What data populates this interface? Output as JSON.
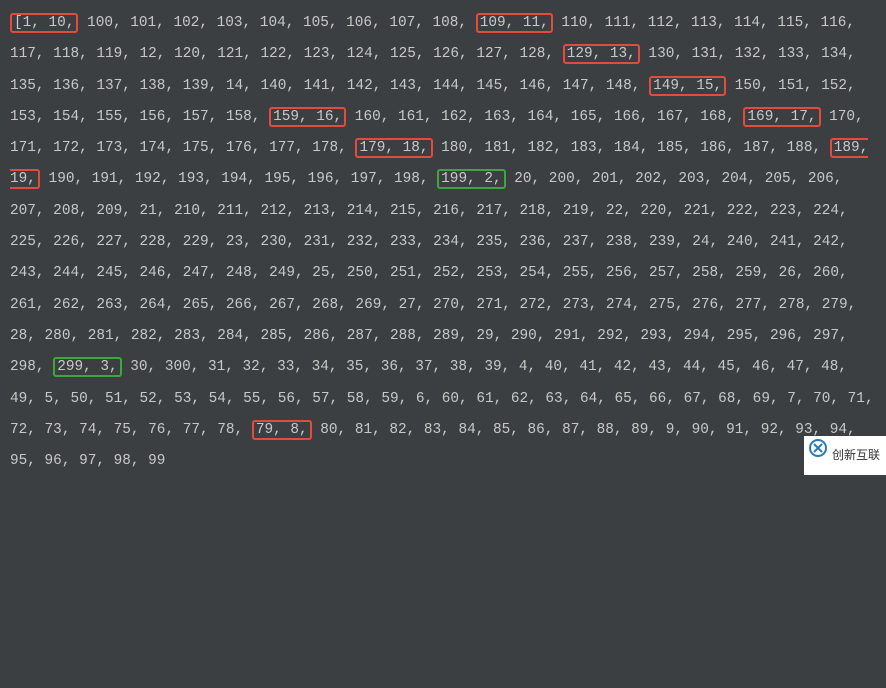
{
  "tokens": [
    {
      "text": "[1, 10,",
      "style": "box-red"
    },
    {
      "text": " 100, 101, 102, 103, 104, 105, 106, 107, 108, "
    },
    {
      "text": "109, 11,",
      "style": "box-red"
    },
    {
      "text": " 110, 111, 112, 113, 114, 115, 116, 117, 118, 119, 12, 120, 121, 122, 123, 124, 125, 126, 127, 128, "
    },
    {
      "text": "129, 13,",
      "style": "box-red"
    },
    {
      "text": " 130, 131, 132, 133, 134, 135, 136, 137, 138, 139, 14, 140, 141, 142, 143, 144, 145, 146, 147, 148, "
    },
    {
      "text": "149, 15,",
      "style": "box-red"
    },
    {
      "text": " 150, 151, 152, 153, 154, 155, 156, 157, 158, "
    },
    {
      "text": "159, 16,",
      "style": "box-red"
    },
    {
      "text": " 160, 161, 162, 163, 164, 165, 166, 167, 168, "
    },
    {
      "text": "169, 17,",
      "style": "box-red"
    },
    {
      "text": " 170, 171, 172, 173, 174, 175, 176, 177, 178, "
    },
    {
      "text": "179, 18,",
      "style": "box-red"
    },
    {
      "text": " 180, 181, 182, 183, 184, 185, 186, 187, 188, "
    },
    {
      "text": "189, 19,",
      "style": "box-red"
    },
    {
      "text": " 190, 191, 192, 193, 194, 195, 196, 197, 198, "
    },
    {
      "text": "199, 2,",
      "style": "box-green"
    },
    {
      "text": " 20, 200, 201, 202, 203, 204, 205, 206, 207, 208, 209, 21, 210, 211, 212, 213, 214, 215, 216, 217, 218, 219, 22, 220, 221, 222, 223, 224, 225, 226, 227, 228, 229, 23, 230, 231, 232, 233, 234, 235, 236, 237, 238, 239, 24, 240, 241, 242, 243, 244, 245, 246, 247, 248, 249, 25, 250, 251, 252, 253, 254, 255, 256, 257, 258, 259, 26, 260, 261, 262, 263, 264, 265, 266, 267, 268, 269, 27, 270, 271, 272, 273, 274, 275, 276, 277, 278, 279, 28, 280, 281, 282, 283, 284, 285, 286, 287, 288, 289, 29, 290, 291, 292, 293, 294, 295, 296, 297, 298, "
    },
    {
      "text": "299, 3,",
      "style": "box-green"
    },
    {
      "text": " 30, 300, 31, 32, 33, 34, 35, 36, 37, 38, 39, 4, 40, 41, 42, 43, 44, 45, 46, 47, 48, 49, 5, 50, 51, 52, 53, 54, 55, 56, 57, 58, 59, 6, 60, 61, 62, 63, 64, 65, 66, 67, 68, 69, 7, 70, 71, 72, 73, 74, 75, 76, 77, 78, "
    },
    {
      "text": "79, 8,",
      "style": "box-red"
    },
    {
      "text": " 80, 81, 82, 83, 84, 85, 86, 87, 88, 89, 9, 90, 91, 92, 93, 94, 95, 96, 97, 98, 99"
    }
  ],
  "watermark": {
    "text": "创新互联"
  }
}
